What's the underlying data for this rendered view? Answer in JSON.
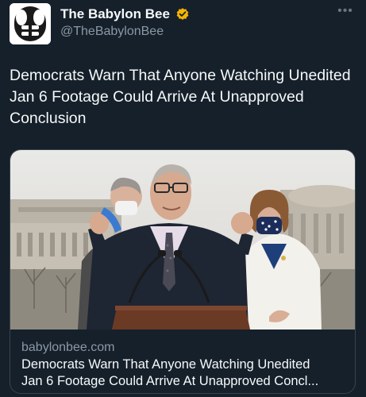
{
  "author": {
    "name": "The Babylon Bee",
    "handle": "@TheBabylonBee",
    "verified_badge_color": "#f4b400",
    "avatar_icon": "bee-logo-icon"
  },
  "more_icon": "more-horizontal-icon",
  "tweet": {
    "text": "Democrats Warn That Anyone Watching Unedited Jan 6 Footage Could Arrive At Unapproved Conclusion"
  },
  "card": {
    "image_icon": "press-conference-photo",
    "domain": "babylonbee.com",
    "title_line1": "Democrats Warn That Anyone Watching Unedited",
    "title_line2": "Jan 6 Footage Could Arrive At Unapproved Concl..."
  },
  "colors": {
    "background": "#15202b",
    "text_primary": "#f7f9f9",
    "text_secondary": "#8b98a5",
    "border": "#38444d"
  }
}
